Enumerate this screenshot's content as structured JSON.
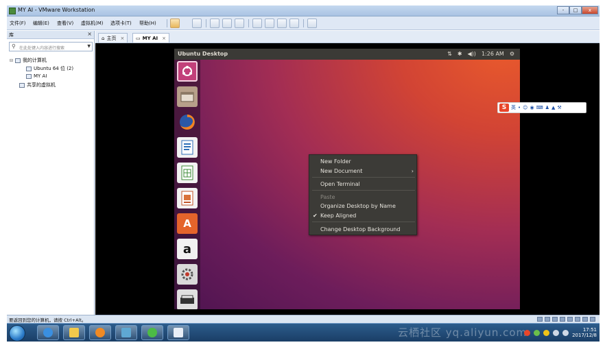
{
  "window": {
    "title": "MY AI - VMware Workstation",
    "buttons": [
      "-",
      "□",
      "x"
    ]
  },
  "menubar": {
    "items": [
      "文件(F)",
      "编辑(E)",
      "查看(V)",
      "虚拟机(M)",
      "选项卡(T)",
      "帮助(H)"
    ],
    "toolbar_icons": [
      "pause-icon",
      "send-ctrl-alt-del-icon",
      "snapshot-icon",
      "revert-snapshot-icon",
      "snapshot-manager-icon",
      "show-library-icon",
      "thumbnail-bar-icon",
      "full-screen-icon",
      "unity-icon",
      "console-view-icon"
    ]
  },
  "library": {
    "title": "库",
    "close": "×",
    "search_placeholder": "在此处键入内容进行搜索",
    "tree": {
      "my_computer": "我的计算机",
      "vm1": "Ubuntu 64 位 (2)",
      "vm2": "MY AI",
      "shared": "共享的虚拟机"
    }
  },
  "tabs": {
    "home": "主页",
    "vm": "MY AI",
    "close": "×"
  },
  "ubuntu": {
    "panel_title": "Ubuntu Desktop",
    "tray": {
      "network": "⇅",
      "bluetooth": "✱",
      "volume": "◀))",
      "time": "1:26 AM",
      "settings": "⚙"
    },
    "launcher": [
      "ubuntu-dash-icon",
      "file-manager-icon",
      "firefox-icon",
      "libreoffice-writer-icon",
      "libreoffice-calc-icon",
      "libreoffice-impress-icon",
      "ubuntu-software-icon",
      "amazon-icon",
      "system-settings-icon",
      "scanner-icon"
    ],
    "launcher_glyphs": {
      "amazon": "a",
      "software": "A"
    },
    "context_menu": {
      "new_folder": "New Folder",
      "new_document": "New Document",
      "submenu_arrow": "›",
      "open_terminal": "Open Terminal",
      "paste": "Paste",
      "organize": "Organize Desktop by Name",
      "keep_aligned": "Keep Aligned",
      "checkmark": "✔",
      "change_bg": "Change Desktop Background"
    }
  },
  "ime": {
    "logo": "S",
    "mode": "英"
  },
  "status": {
    "text": "要返回到您的计算机，请按 Ctrl+Alt。"
  },
  "taskbar": {
    "clock_time": "17:51",
    "clock_date": "2017/12/8"
  },
  "watermark": "云栖社区 yq.aliyun.com",
  "colors": {
    "ubuntu_orange": "#e95420",
    "ubuntu_aubergine": "#77216f",
    "vmware_blue": "#dfe8f5"
  }
}
